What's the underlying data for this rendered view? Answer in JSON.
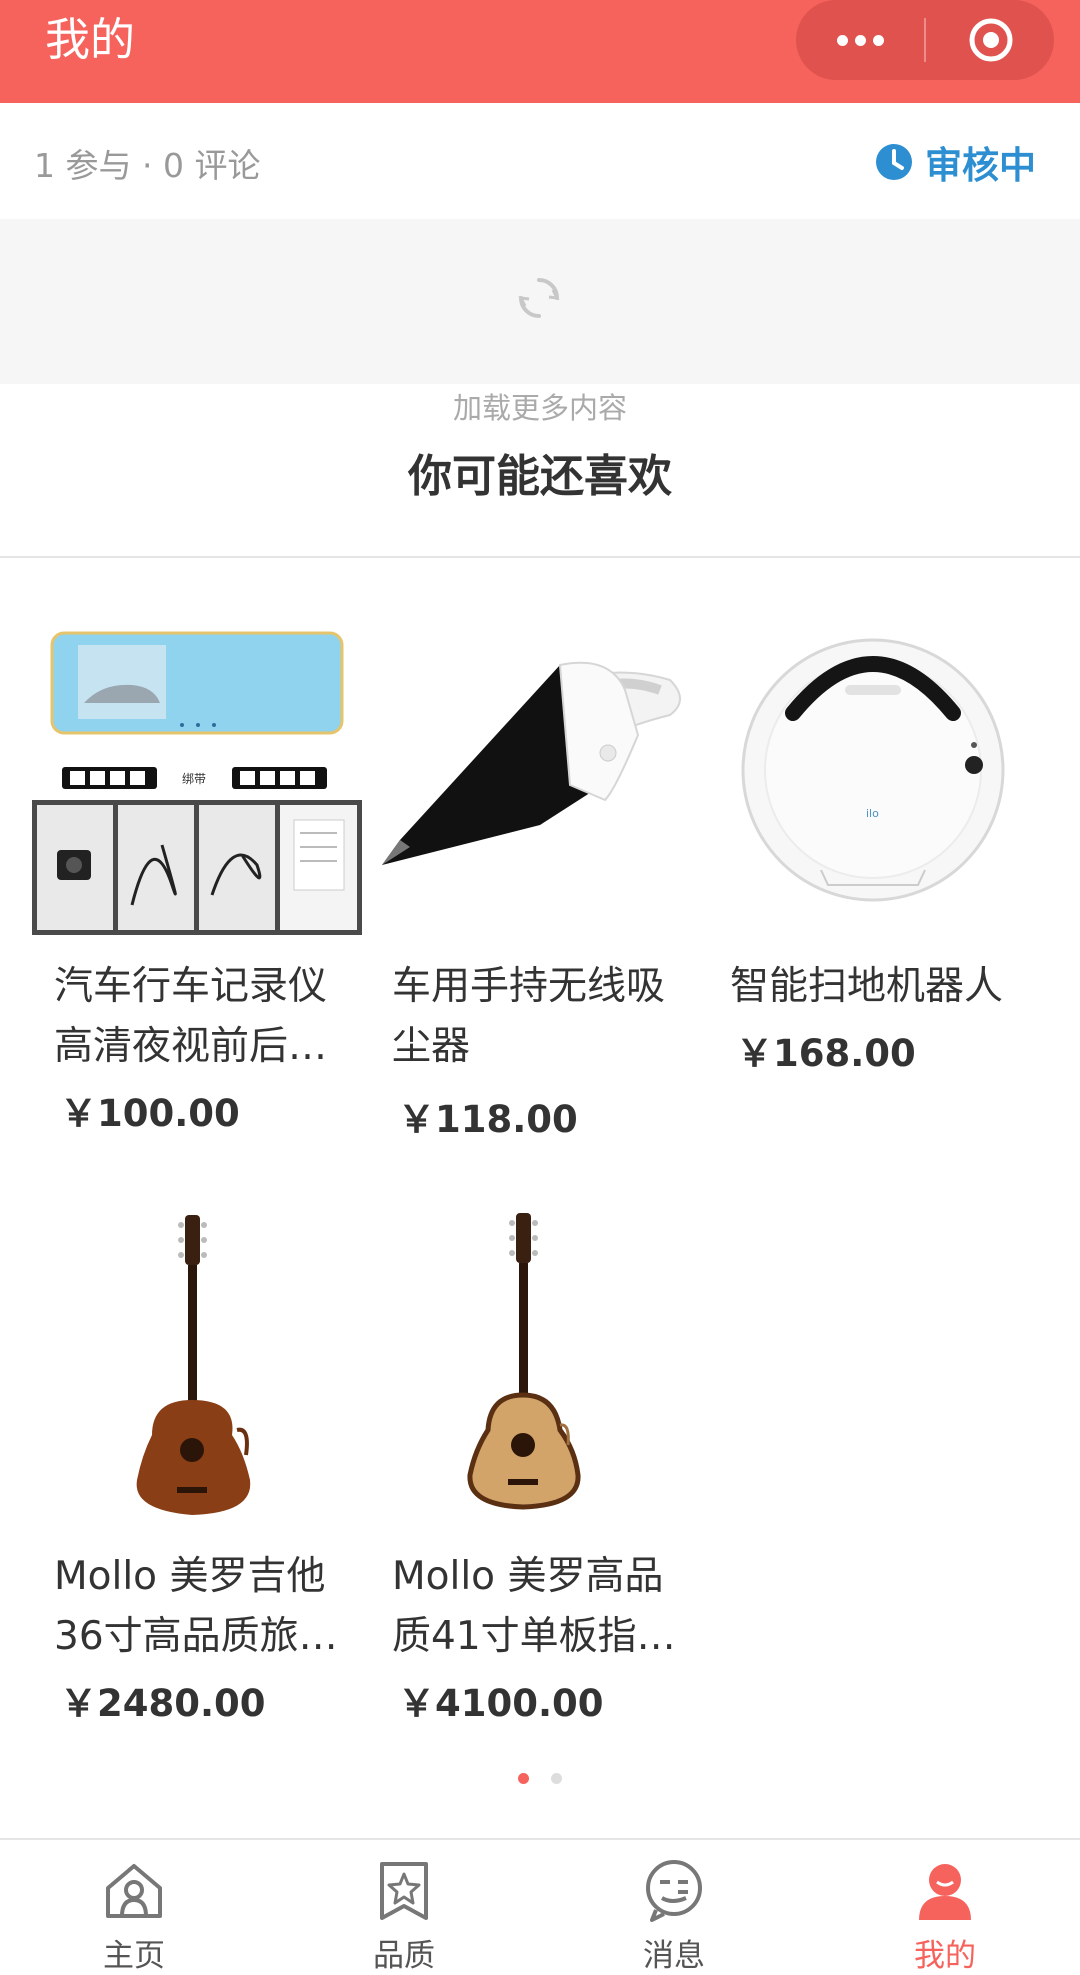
{
  "nav": {
    "title": "我的",
    "more_icon": "more-dots-icon",
    "close_icon": "target-close-icon",
    "bg_color": "#f6635d"
  },
  "stats": {
    "text": "1 参与 · 0 评论",
    "status_label": "审核中",
    "status_icon": "clock-icon",
    "status_color": "#2d8fd2"
  },
  "loading": {
    "icon": "refresh-spinner-icon",
    "load_more": "加载更多内容"
  },
  "recommend": {
    "title": "你可能还喜欢",
    "products": [
      {
        "title_line1": "汽车行车记录仪",
        "title_line2": "高清夜视前后…",
        "price": "￥100.00",
        "image": "dashcam-image",
        "strap_label": "绑带"
      },
      {
        "title_line1": "车用手持无线吸",
        "title_line2": "尘器",
        "price": "￥118.00",
        "image": "vacuum-image"
      },
      {
        "title_line1": "智能扫地机器人",
        "title_line2": "",
        "price": "￥168.00",
        "image": "robot-vacuum-image"
      },
      {
        "title_line1": "Mollo 美罗吉他",
        "title_line2": "36寸高品质旅…",
        "price": "￥2480.00",
        "image": "guitar-dark-image"
      },
      {
        "title_line1": "Mollo 美罗高品",
        "title_line2": "质41寸单板指…",
        "price": "￥4100.00",
        "image": "guitar-light-image"
      }
    ],
    "page_dots": {
      "current": 1,
      "total": 2
    }
  },
  "tabbar": {
    "items": [
      {
        "label": "主页",
        "icon": "home-icon",
        "active": false
      },
      {
        "label": "品质",
        "icon": "quality-star-icon",
        "active": false
      },
      {
        "label": "消息",
        "icon": "message-icon",
        "active": false
      },
      {
        "label": "我的",
        "icon": "profile-icon",
        "active": true
      }
    ],
    "active_color": "#f6635d"
  }
}
